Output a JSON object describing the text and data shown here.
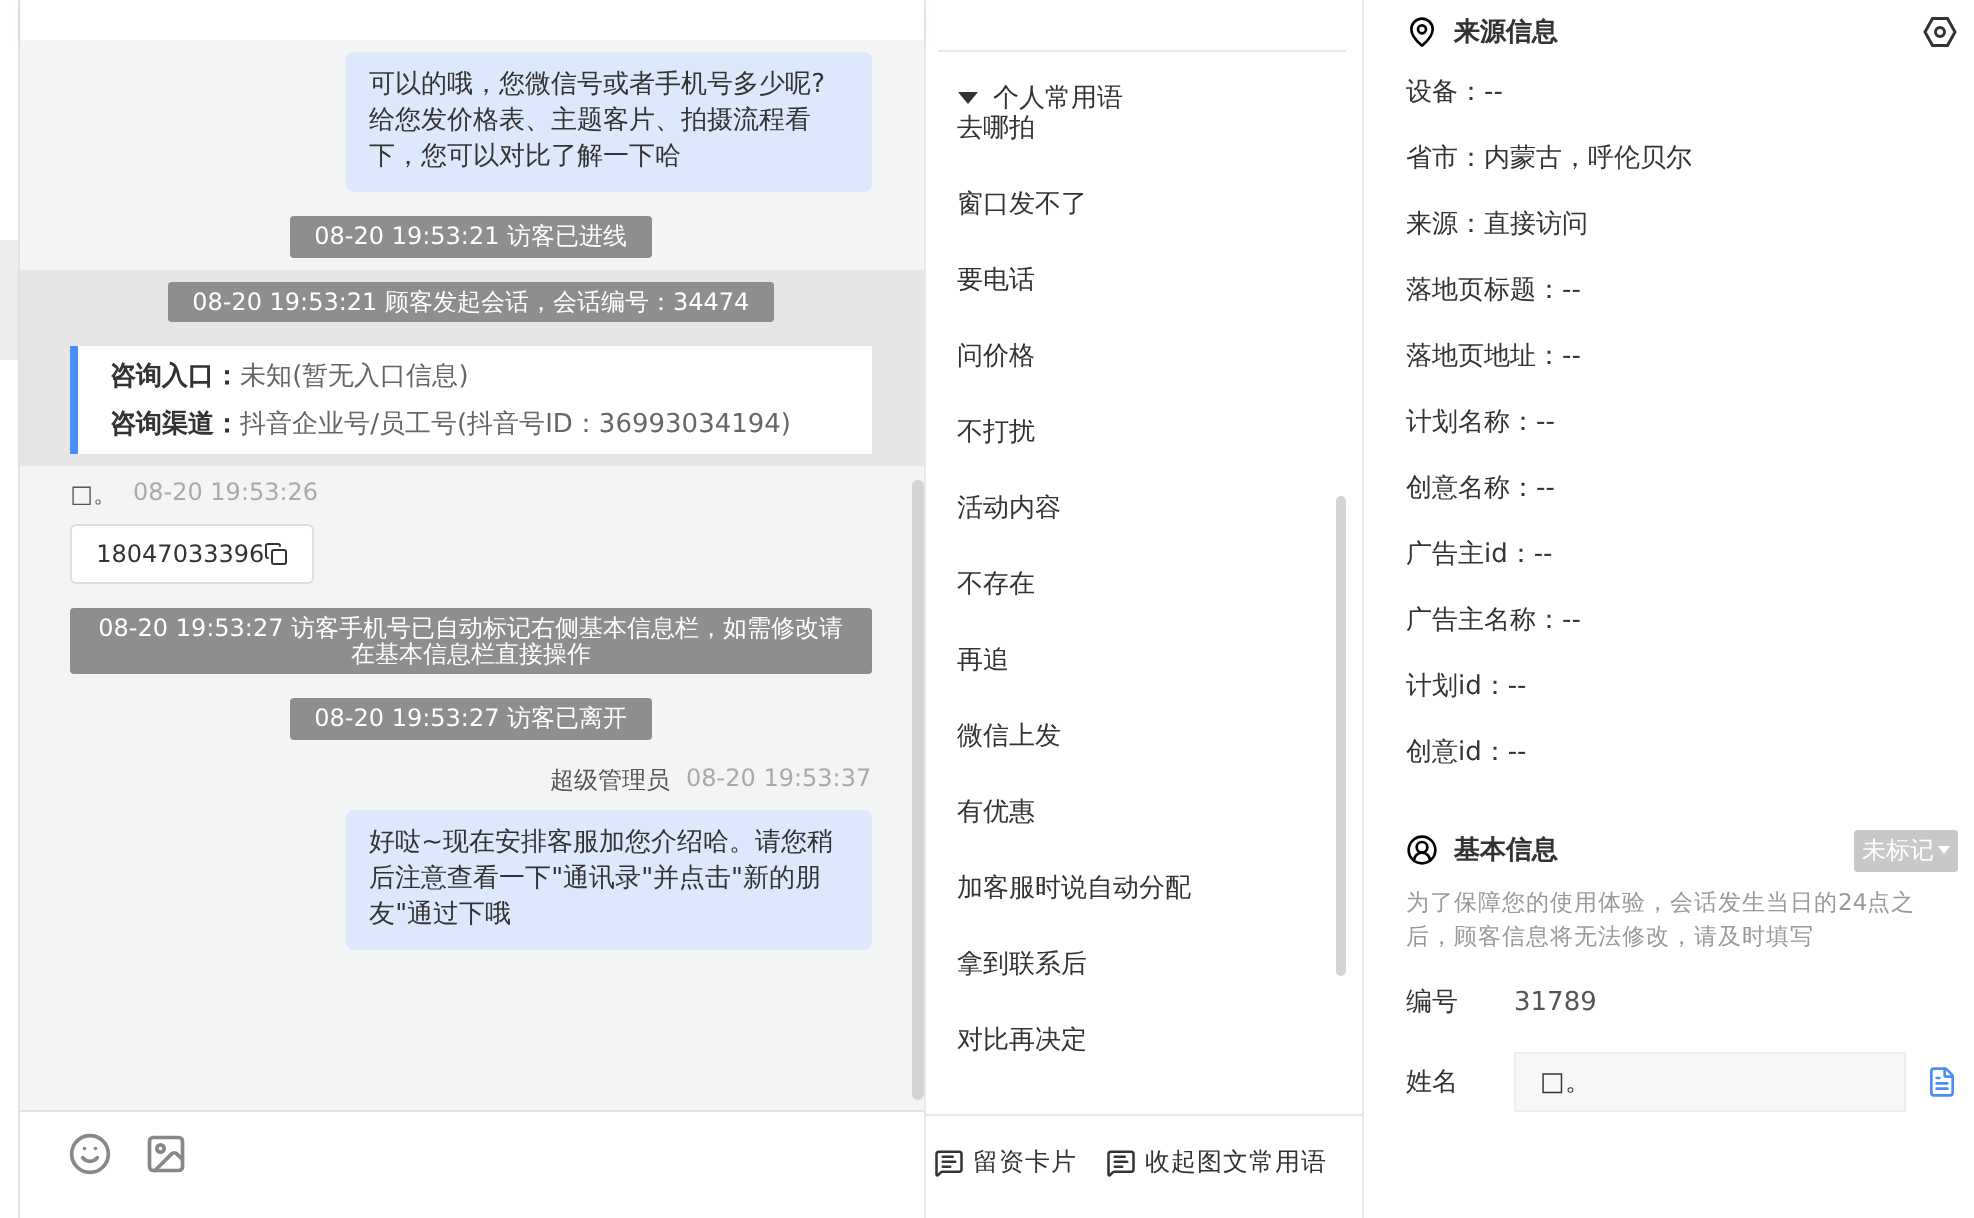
{
  "chat": {
    "messages": [
      {
        "kind": "agent",
        "text": "可以的哦，您微信号或者手机号多少呢?给您发价格表、主题客片、拍摄流程看下，您可以对比了解一下哈"
      },
      {
        "kind": "system",
        "text": "08-20 19:53:21 访客已进线"
      },
      {
        "kind": "system",
        "text": "08-20 19:53:21 顾客发起会话，会话编号：34474",
        "highlight": true
      },
      {
        "kind": "info",
        "highlight": true,
        "rows": [
          {
            "label": "咨询入口：",
            "value": "未知(暂无入口信息)"
          },
          {
            "label": "咨询渠道：",
            "value": "抖音企业号/员工号(抖音号ID：36993034194)"
          }
        ]
      },
      {
        "kind": "visitor",
        "sender": "□。",
        "time": "08-20 19:53:26",
        "text": "18047033396"
      },
      {
        "kind": "system",
        "text": "08-20 19:53:27 访客手机号已自动标记右侧基本信息栏，如需修改请在基本信息栏直接操作"
      },
      {
        "kind": "system",
        "text": "08-20 19:53:27 访客已离开"
      },
      {
        "kind": "agent",
        "sender": "超级管理员",
        "time": "08-20 19:53:37",
        "text": "好哒~现在安排客服加您介绍哈。请您稍后注意查看一下\"通讯录\"并点击\"新的朋友\"通过下哦"
      }
    ]
  },
  "phrases": {
    "group": {
      "title": "个人常用语",
      "expanded": true
    },
    "items": [
      "去哪拍",
      "窗口发不了",
      "要电话",
      "问价格",
      "不打扰",
      "活动内容",
      "不存在",
      "再追",
      "微信上发",
      "有优惠",
      "加客服时说自动分配",
      "拿到联系后",
      "对比再决定"
    ],
    "actions": [
      "留资卡片",
      "收起图文常用语"
    ]
  },
  "source_info": {
    "title": "来源信息",
    "fields": [
      "设备：--",
      "省市：内蒙古，呼伦贝尔",
      "来源：直接访问",
      "落地页标题：--",
      "落地页地址：--",
      "计划名称：--",
      "创意名称：--",
      "广告主id：--",
      "广告主名称：--",
      "计划id：--",
      "创意id：--"
    ]
  },
  "basic_info": {
    "title": "基本信息",
    "tag": "未标记",
    "notice": "为了保障您的使用体验，会话发生当日的24点之后，顾客信息将无法修改，请及时填写",
    "fields": [
      {
        "kind": "text",
        "label": "编号",
        "value": "31789"
      },
      {
        "kind": "input",
        "label": "姓名",
        "value": "□。"
      }
    ]
  }
}
